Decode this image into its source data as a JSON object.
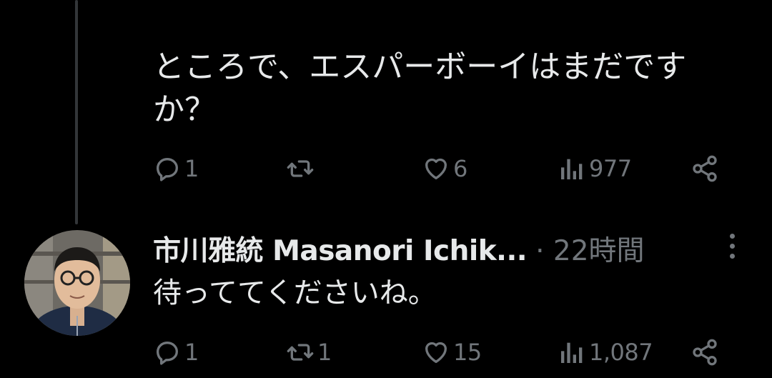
{
  "colors": {
    "background": "#000000",
    "text_primary": "#e7e9ea",
    "text_secondary": "#71767b",
    "thread_line": "#333639"
  },
  "tweet1": {
    "text": "ところで、エスパーボーイはまだですか？",
    "actions": {
      "reply_icon": "reply-icon",
      "reply_count": "1",
      "retweet_icon": "retweet-icon",
      "retweet_count": "",
      "like_icon": "heart-icon",
      "like_count": "6",
      "views_icon": "views-chart-icon",
      "views_count": "977",
      "share_icon": "share-icon"
    }
  },
  "tweet2": {
    "author": {
      "display_name": "市川雅統 Masanori Ichik...",
      "avatar": "avatar"
    },
    "meta": "· 22時間",
    "more_icon": "more-vertical-icon",
    "text": "待っててくださいね。",
    "actions": {
      "reply_icon": "reply-icon",
      "reply_count": "1",
      "retweet_icon": "retweet-icon",
      "retweet_count": "1",
      "like_icon": "heart-icon",
      "like_count": "15",
      "views_icon": "views-chart-icon",
      "views_count": "1,087",
      "share_icon": "share-icon"
    }
  }
}
